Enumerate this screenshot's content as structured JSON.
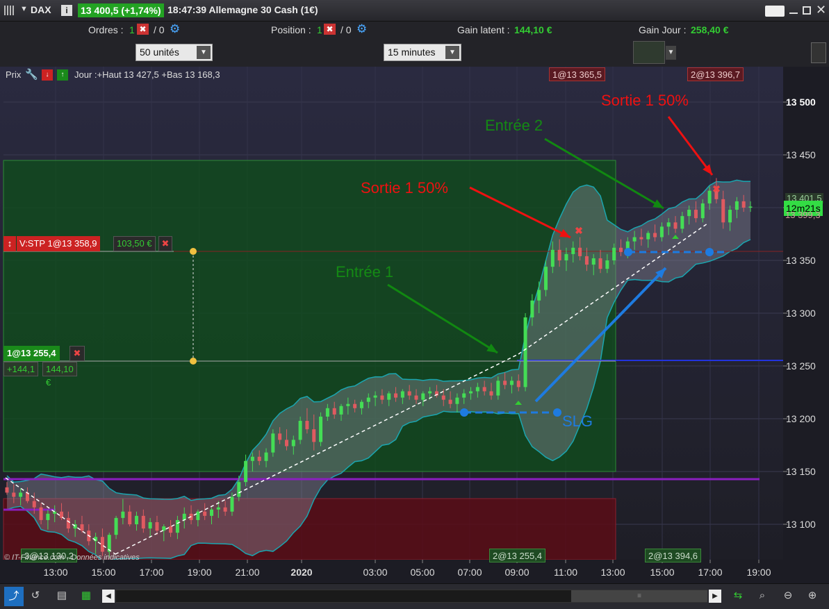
{
  "titlebar": {
    "instrument": "DAX",
    "price_change": "13 400,5 (+1,74%)",
    "time_name": "18:47:39 Allemagne 30 Cash (1€)"
  },
  "infobar": {
    "orders_label": "Ordres :",
    "orders_count": "1",
    "orders_zero": "/ 0",
    "position_label": "Position :",
    "position_count": "1",
    "position_zero": "/ 0",
    "gain_latent_label": "Gain latent :",
    "gain_latent_value": "144,10 €",
    "gain_jour_label": "Gain Jour :",
    "gain_jour_value": "258,40 €"
  },
  "toolbar": {
    "units_value": "50 unités",
    "interval_value": "15 minutes"
  },
  "chart_header": {
    "prix_label": "Prix",
    "day_range": "Jour :+Haut 13 427,5 +Bas 13 168,3",
    "exec_tag_1": "1@13 365,5",
    "exec_tag_2": "2@13 396,7"
  },
  "orders": {
    "stop_label": "V:STP 1@13 358,9",
    "stop_value": "103,50 €",
    "position_label": "1@13 255,4",
    "position_pts": "+144,1",
    "position_value": "144,10 €"
  },
  "annotations": {
    "sortie_1": "Sortie 1 50%",
    "sortie_2": "Sortie 1 50%",
    "entree_1": "Entrée 1",
    "entree_2": "Entrée 2",
    "slg": "SLG"
  },
  "bottom_tags": {
    "tag_left": "3@13 130,2",
    "tag_mid": "2@13 255,4",
    "tag_right": "2@13 394,6",
    "copyright": "© IT-Finance.com - Données indicatives"
  },
  "price_axis": {
    "labels": [
      "13 500",
      "13 450",
      "13 400",
      "13 350",
      "13 300",
      "13 250",
      "13 200",
      "13 150",
      "13 100"
    ],
    "current_price_tag": "13 401,5",
    "timer_tag": "12m21s",
    "partial_tag": "13 399,3"
  },
  "time_axis": {
    "labels": [
      "13:00",
      "15:00",
      "17:00",
      "19:00",
      "21:00",
      "2020",
      "03:00",
      "05:00",
      "07:00",
      "09:00",
      "11:00",
      "13:00",
      "15:00",
      "17:00",
      "19:00"
    ]
  },
  "colors": {
    "up": "#44dd55",
    "down": "#e05a60",
    "green_text": "#33cc33",
    "red_arrow": "#ee1111",
    "green_arrow": "#118811",
    "blue": "#1e7be0",
    "bollinger_edge": "#1aa6b0",
    "purple": "#8a1fbf"
  },
  "chart_data": {
    "type": "candlestick",
    "interval": "15 minutes",
    "ylim": [
      13060,
      13525
    ],
    "y_ticks": [
      13100,
      13150,
      13200,
      13250,
      13300,
      13350,
      13400,
      13450,
      13500
    ],
    "x_labels": [
      "13:00",
      "15:00",
      "17:00",
      "19:00",
      "21:00",
      "2020",
      "03:00",
      "05:00",
      "07:00",
      "09:00",
      "11:00",
      "13:00",
      "15:00",
      "17:00",
      "19:00"
    ],
    "candles": [
      [
        13135,
        13140,
        13128,
        13130
      ],
      [
        13130,
        13138,
        13120,
        13126
      ],
      [
        13126,
        13134,
        13118,
        13130
      ],
      [
        13130,
        13135,
        13120,
        13122
      ],
      [
        13122,
        13130,
        13110,
        13116
      ],
      [
        13116,
        13120,
        13100,
        13104
      ],
      [
        13104,
        13114,
        13095,
        13110
      ],
      [
        13110,
        13118,
        13102,
        13112
      ],
      [
        13112,
        13120,
        13104,
        13106
      ],
      [
        13106,
        13112,
        13092,
        13096
      ],
      [
        13096,
        13104,
        13088,
        13100
      ],
      [
        13100,
        13108,
        13092,
        13094
      ],
      [
        13094,
        13100,
        13080,
        13084
      ],
      [
        13084,
        13092,
        13072,
        13088
      ],
      [
        13088,
        13096,
        13070,
        13074
      ],
      [
        13074,
        13092,
        13068,
        13090
      ],
      [
        13090,
        13108,
        13086,
        13106
      ],
      [
        13106,
        13124,
        13100,
        13112
      ],
      [
        13112,
        13118,
        13098,
        13100
      ],
      [
        13100,
        13112,
        13094,
        13108
      ],
      [
        13108,
        13114,
        13092,
        13096
      ],
      [
        13096,
        13106,
        13088,
        13102
      ],
      [
        13102,
        13108,
        13090,
        13094
      ],
      [
        13094,
        13100,
        13084,
        13098
      ],
      [
        13098,
        13104,
        13088,
        13092
      ],
      [
        13092,
        13108,
        13086,
        13104
      ],
      [
        13104,
        13116,
        13096,
        13110
      ],
      [
        13110,
        13118,
        13100,
        13104
      ],
      [
        13104,
        13114,
        13098,
        13112
      ],
      [
        13112,
        13120,
        13104,
        13108
      ],
      [
        13108,
        13116,
        13100,
        13114
      ],
      [
        13114,
        13122,
        13106,
        13116
      ],
      [
        13116,
        13122,
        13108,
        13112
      ],
      [
        13112,
        13130,
        13108,
        13126
      ],
      [
        13126,
        13146,
        13122,
        13140
      ],
      [
        13140,
        13166,
        13136,
        13160
      ],
      [
        13160,
        13168,
        13150,
        13164
      ],
      [
        13164,
        13170,
        13156,
        13160
      ],
      [
        13160,
        13172,
        13154,
        13168
      ],
      [
        13168,
        13190,
        13164,
        13186
      ],
      [
        13186,
        13192,
        13176,
        13180
      ],
      [
        13180,
        13190,
        13170,
        13174
      ],
      [
        13174,
        13184,
        13166,
        13180
      ],
      [
        13180,
        13202,
        13176,
        13198
      ],
      [
        13198,
        13210,
        13186,
        13190
      ],
      [
        13190,
        13204,
        13170,
        13178
      ],
      [
        13178,
        13206,
        13174,
        13202
      ],
      [
        13202,
        13214,
        13198,
        13210
      ],
      [
        13210,
        13216,
        13200,
        13204
      ],
      [
        13204,
        13214,
        13198,
        13212
      ],
      [
        13212,
        13220,
        13204,
        13214
      ],
      [
        13214,
        13218,
        13206,
        13210
      ],
      [
        13210,
        13218,
        13204,
        13216
      ],
      [
        13216,
        13224,
        13210,
        13220
      ],
      [
        13220,
        13226,
        13212,
        13222
      ],
      [
        13222,
        13228,
        13214,
        13218
      ],
      [
        13218,
        13226,
        13212,
        13224
      ],
      [
        13224,
        13230,
        13216,
        13220
      ],
      [
        13220,
        13228,
        13214,
        13226
      ],
      [
        13226,
        13232,
        13218,
        13222
      ],
      [
        13222,
        13228,
        13214,
        13218
      ],
      [
        13218,
        13226,
        13212,
        13224
      ],
      [
        13224,
        13230,
        13218,
        13226
      ],
      [
        13226,
        13232,
        13220,
        13222
      ],
      [
        13222,
        13228,
        13212,
        13218
      ],
      [
        13218,
        13226,
        13210,
        13214
      ],
      [
        13214,
        13224,
        13206,
        13220
      ],
      [
        13220,
        13228,
        13214,
        13224
      ],
      [
        13224,
        13230,
        13218,
        13226
      ],
      [
        13226,
        13234,
        13220,
        13230
      ],
      [
        13230,
        13236,
        13222,
        13226
      ],
      [
        13226,
        13234,
        13218,
        13222
      ],
      [
        13222,
        13240,
        13218,
        13236
      ],
      [
        13236,
        13244,
        13228,
        13232
      ],
      [
        13232,
        13240,
        13224,
        13236
      ],
      [
        13236,
        13242,
        13226,
        13230
      ],
      [
        13230,
        13300,
        13226,
        13296
      ],
      [
        13296,
        13318,
        13288,
        13312
      ],
      [
        13312,
        13330,
        13300,
        13322
      ],
      [
        13322,
        13350,
        13316,
        13344
      ],
      [
        13344,
        13368,
        13338,
        13360
      ],
      [
        13360,
        13370,
        13344,
        13350
      ],
      [
        13350,
        13362,
        13340,
        13356
      ],
      [
        13356,
        13368,
        13348,
        13362
      ],
      [
        13362,
        13372,
        13350,
        13354
      ],
      [
        13354,
        13362,
        13340,
        13346
      ],
      [
        13346,
        13356,
        13336,
        13352
      ],
      [
        13352,
        13360,
        13338,
        13342
      ],
      [
        13342,
        13356,
        13338,
        13350
      ],
      [
        13350,
        13366,
        13346,
        13362
      ],
      [
        13362,
        13370,
        13354,
        13358
      ],
      [
        13358,
        13372,
        13352,
        13368
      ],
      [
        13368,
        13378,
        13360,
        13372
      ],
      [
        13372,
        13380,
        13364,
        13370
      ],
      [
        13370,
        13378,
        13362,
        13376
      ],
      [
        13376,
        13384,
        13368,
        13372
      ],
      [
        13372,
        13386,
        13368,
        13382
      ],
      [
        13382,
        13390,
        13374,
        13386
      ],
      [
        13386,
        13392,
        13376,
        13380
      ],
      [
        13380,
        13396,
        13376,
        13392
      ],
      [
        13392,
        13402,
        13384,
        13398
      ],
      [
        13398,
        13406,
        13386,
        13390
      ],
      [
        13390,
        13408,
        13386,
        13404
      ],
      [
        13404,
        13420,
        13398,
        13416
      ],
      [
        13416,
        13428,
        13404,
        13408
      ],
      [
        13408,
        13416,
        13380,
        13386
      ],
      [
        13386,
        13402,
        13378,
        13398
      ],
      [
        13398,
        13410,
        13390,
        13406
      ],
      [
        13406,
        13412,
        13396,
        13400
      ],
      [
        13400,
        13406,
        13396,
        13401
      ]
    ]
  }
}
